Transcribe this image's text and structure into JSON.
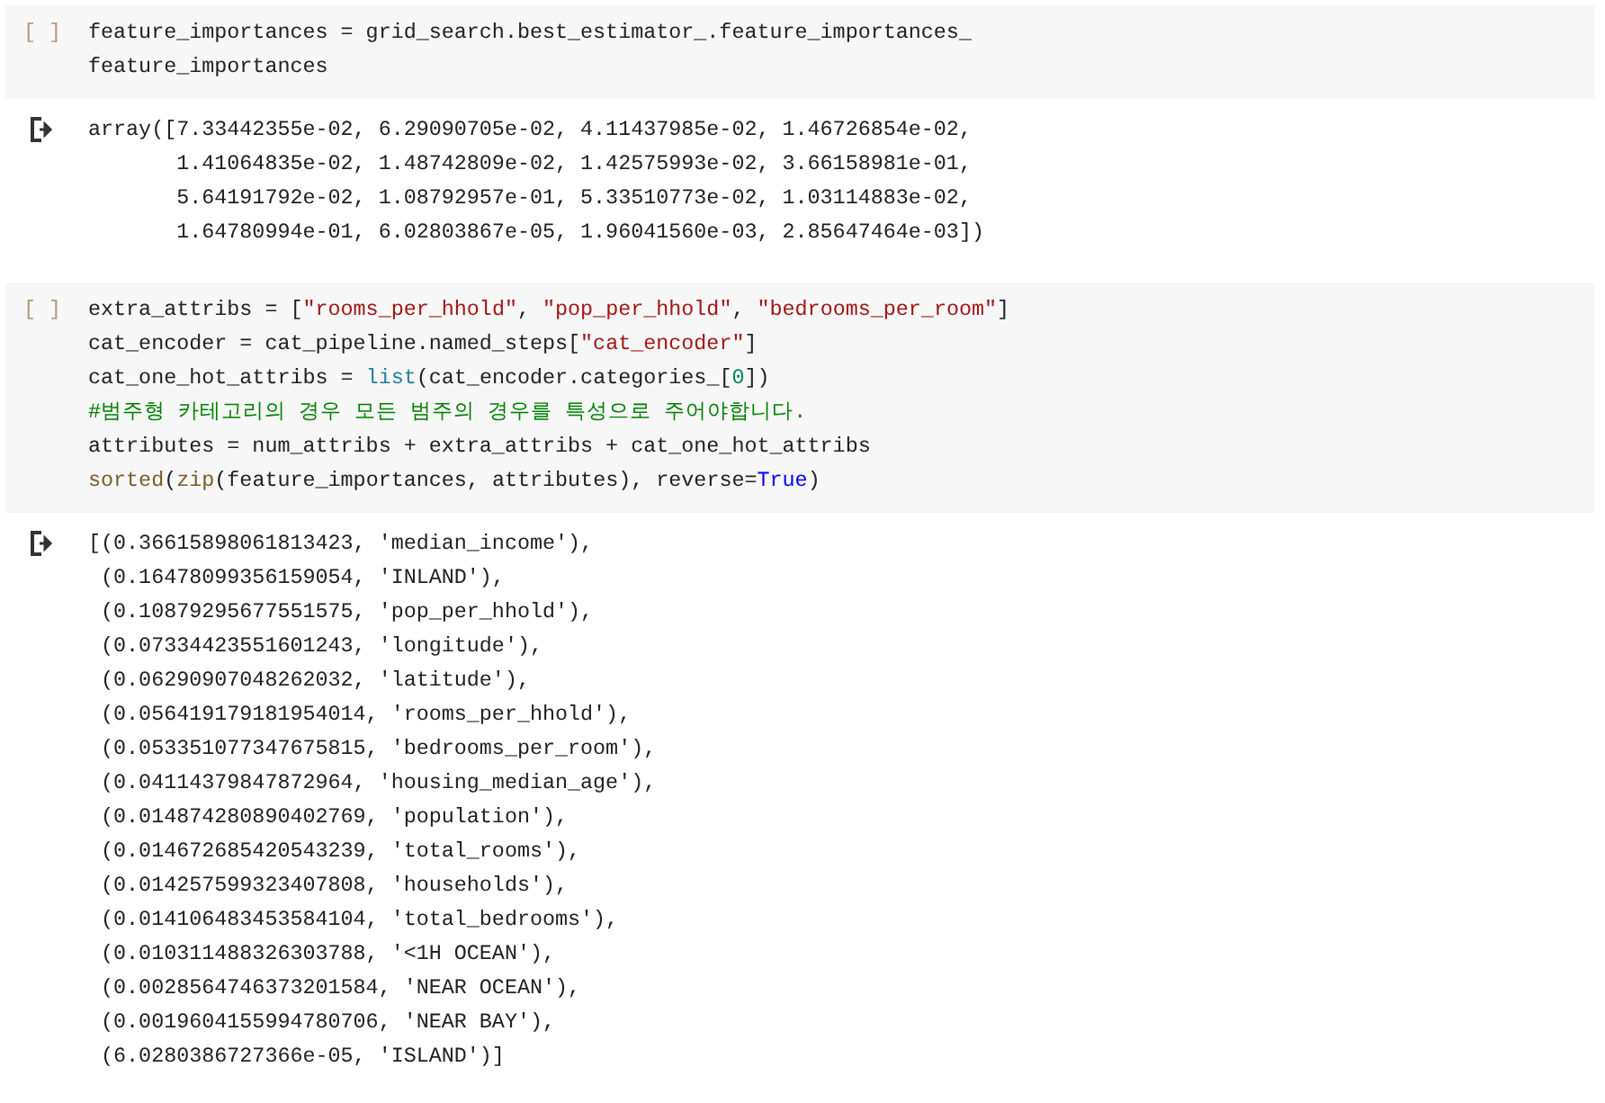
{
  "cells": [
    {
      "kind": "code",
      "prompt": "[ ]",
      "lines": [
        [
          {
            "kind": "plain",
            "text": "feature_importances = grid_search.best_estimator_.feature_importances_"
          }
        ],
        [
          {
            "kind": "plain",
            "text": "feature_importances"
          }
        ]
      ]
    },
    {
      "kind": "output",
      "lines": [
        "array([7.33442355e-02, 6.29090705e-02, 4.11437985e-02, 1.46726854e-02,",
        "       1.41064835e-02, 1.48742809e-02, 1.42575993e-02, 3.66158981e-01,",
        "       5.64191792e-02, 1.08792957e-01, 5.33510773e-02, 1.03114883e-02,",
        "       1.64780994e-01, 6.02803867e-05, 1.96041560e-03, 2.85647464e-03])"
      ]
    },
    {
      "kind": "code",
      "prompt": "[ ]",
      "lines": [
        [
          {
            "kind": "plain",
            "text": "extra_attribs = ["
          },
          {
            "kind": "string",
            "text": "\"rooms_per_hhold\""
          },
          {
            "kind": "plain",
            "text": ", "
          },
          {
            "kind": "string",
            "text": "\"pop_per_hhold\""
          },
          {
            "kind": "plain",
            "text": ", "
          },
          {
            "kind": "string",
            "text": "\"bedrooms_per_room\""
          },
          {
            "kind": "plain",
            "text": "]"
          }
        ],
        [
          {
            "kind": "plain",
            "text": "cat_encoder = cat_pipeline.named_steps["
          },
          {
            "kind": "string",
            "text": "\"cat_encoder\""
          },
          {
            "kind": "plain",
            "text": "]"
          }
        ],
        [
          {
            "kind": "plain",
            "text": "cat_one_hot_attribs = "
          },
          {
            "kind": "builtin",
            "text": "list"
          },
          {
            "kind": "plain",
            "text": "(cat_encoder.categories_["
          },
          {
            "kind": "number",
            "text": "0"
          },
          {
            "kind": "plain",
            "text": "])"
          }
        ],
        [
          {
            "kind": "comment",
            "text": "#범주형 카테고리의 경우 모든 범주의 경우를 특성으로 주어야합니다."
          }
        ],
        [
          {
            "kind": "plain",
            "text": "attributes = num_attribs + extra_attribs + cat_one_hot_attribs"
          }
        ],
        [
          {
            "kind": "function",
            "text": "sorted"
          },
          {
            "kind": "plain",
            "text": "("
          },
          {
            "kind": "function",
            "text": "zip"
          },
          {
            "kind": "plain",
            "text": "(feature_importances, attributes), reverse="
          },
          {
            "kind": "keyword",
            "text": "True"
          },
          {
            "kind": "plain",
            "text": ")"
          }
        ]
      ]
    },
    {
      "kind": "output",
      "lines": [
        "[(0.36615898061813423, 'median_income'),",
        " (0.16478099356159054, 'INLAND'),",
        " (0.10879295677551575, 'pop_per_hhold'),",
        " (0.07334423551601243, 'longitude'),",
        " (0.06290907048262032, 'latitude'),",
        " (0.056419179181954014, 'rooms_per_hhold'),",
        " (0.053351077347675815, 'bedrooms_per_room'),",
        " (0.04114379847872964, 'housing_median_age'),",
        " (0.014874280890402769, 'population'),",
        " (0.014672685420543239, 'total_rooms'),",
        " (0.014257599323407808, 'households'),",
        " (0.014106483453584104, 'total_bedrooms'),",
        " (0.010311488326303788, '<1H OCEAN'),",
        " (0.0028564746373201584, 'NEAR OCEAN'),",
        " (0.0019604155994780706, 'NEAR BAY'),",
        " (6.0280386727366e-05, 'ISLAND')]"
      ]
    }
  ]
}
